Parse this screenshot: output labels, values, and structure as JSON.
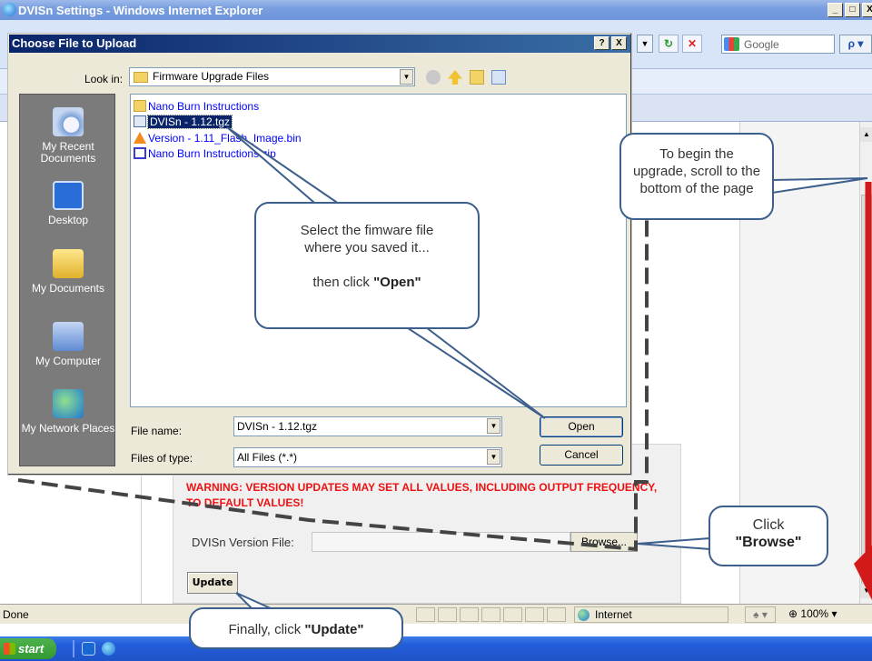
{
  "window": {
    "title": "DVISn Settings - Windows Internet Explorer",
    "controls": [
      "_",
      "□",
      "X"
    ]
  },
  "toolbar": {
    "search_placeholder": "Google",
    "search_button": "ρ ▾"
  },
  "dialog": {
    "title": "Choose File to Upload",
    "title_buttons": [
      "?",
      "X"
    ],
    "look_in_label": "Look in:",
    "look_in_value": "Firmware Upgrade Files",
    "places": [
      {
        "label": "My Recent Documents",
        "icon": "recent-documents-icon"
      },
      {
        "label": "Desktop",
        "icon": "desktop-icon"
      },
      {
        "label": "My Documents",
        "icon": "my-documents-icon"
      },
      {
        "label": "My Computer",
        "icon": "my-computer-icon"
      },
      {
        "label": "My Network Places",
        "icon": "network-places-icon"
      }
    ],
    "files": [
      {
        "name": "Nano Burn Instructions",
        "icon": "folder-icon"
      },
      {
        "name": "DVISn - 1.12.tgz",
        "icon": "archive-file-icon",
        "selected": true
      },
      {
        "name": "Version - 1.11_Flash_Image.bin",
        "icon": "vlc-file-icon"
      },
      {
        "name": "Nano Burn Instructions.zip",
        "icon": "zip-file-icon"
      }
    ],
    "file_name_label": "File name:",
    "file_name_value": "DVISn - 1.12.tgz",
    "file_type_label": "Files of type:",
    "file_type_value": "All Files (*.*)",
    "open_label": "Open",
    "cancel_label": "Cancel"
  },
  "page": {
    "warning_line1": "WARNING: VERSION UPDATES MAY SET ALL VALUES, INCLUDING OUTPUT FREQUENCY,",
    "warning_line2": "TO DEFAULT VALUES!",
    "version_file_label": "DVISn Version File:",
    "version_file_value": "",
    "browse_label": "Browse...",
    "update_label": "Update"
  },
  "statusbar": {
    "status": "Done",
    "zone": "Internet",
    "zoom": "100%"
  },
  "taskbar": {
    "start_label": "start"
  },
  "callouts": {
    "select_line1": "Select the fimware file",
    "select_line2": "where you saved it...",
    "select_line3": "then click ",
    "select_bold": "\"Open\"",
    "begin_line1": "To begin the",
    "begin_line2": "upgrade, scroll to the",
    "begin_line3": "bottom of the page",
    "browse_line1": "Click",
    "browse_bold": "\"Browse\"",
    "update_text": "Finally, click ",
    "update_bold": "\"Update\""
  },
  "colors": {
    "dialog_title_bar": "#0a246a",
    "warning_text": "#ee1111",
    "callout_border": "#3d5f8c",
    "arrow": "#d21a1a"
  }
}
